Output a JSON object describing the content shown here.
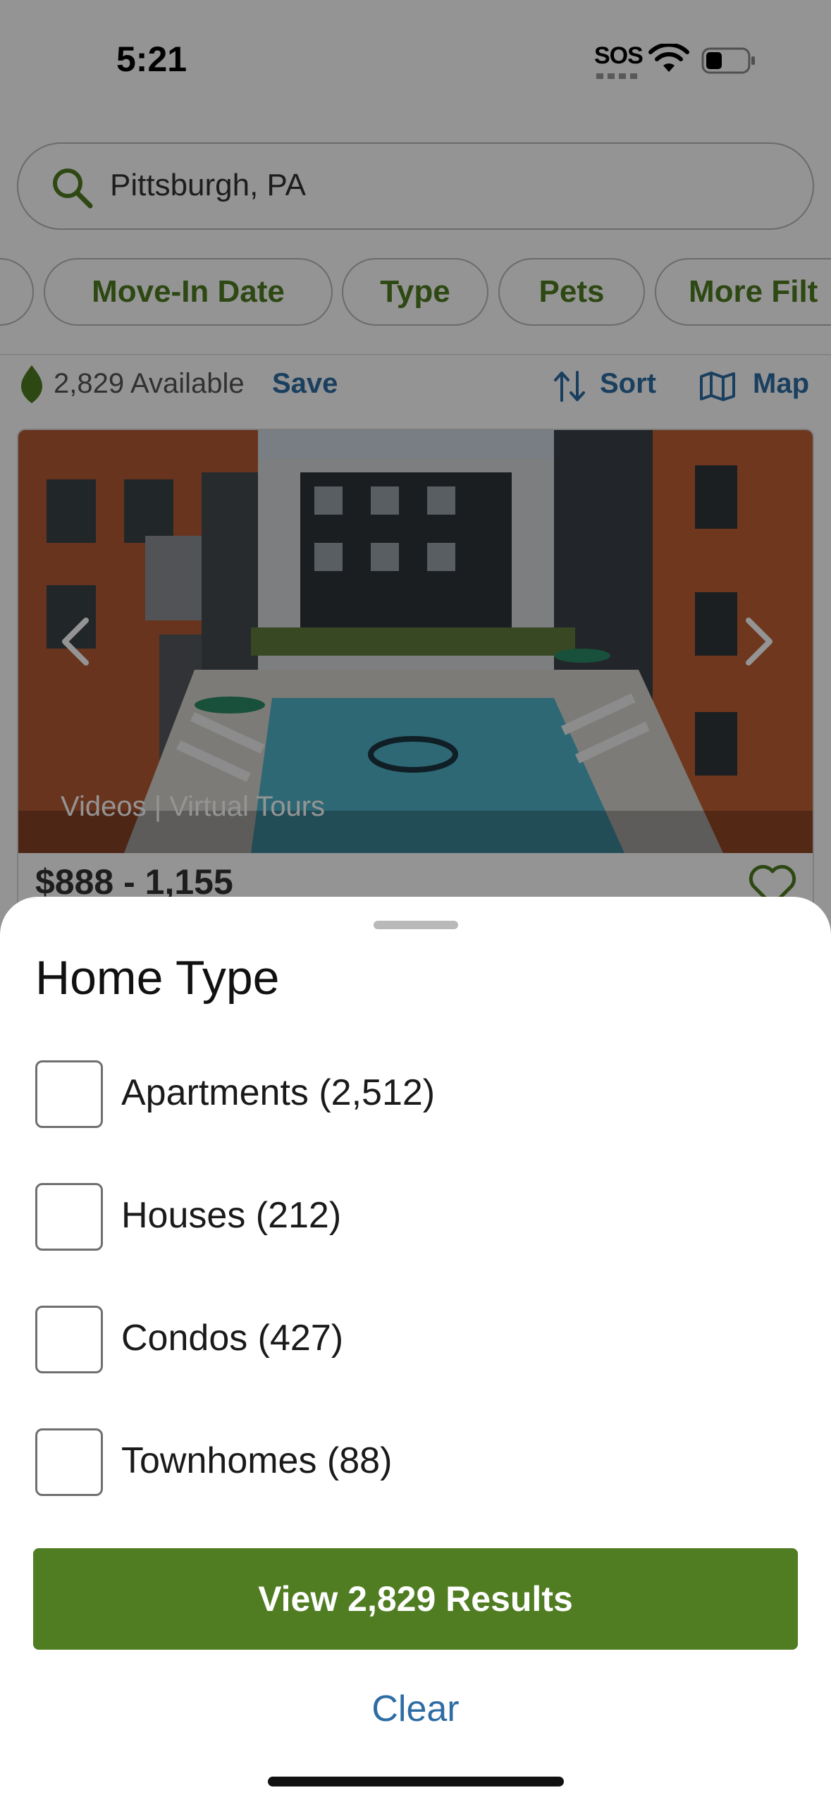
{
  "status_bar": {
    "time": "5:21",
    "sos": "SOS",
    "icons": [
      "wifi-icon",
      "battery-icon"
    ]
  },
  "search": {
    "value": "Pittsburgh, PA",
    "icon": "search-icon"
  },
  "filters": {
    "chips": [
      "Move-In Date",
      "Type",
      "Pets",
      "More Filt"
    ]
  },
  "results_bar": {
    "available": "2,829 Available",
    "save": "Save",
    "sort": "Sort",
    "map": "Map"
  },
  "listing": {
    "media": "Videos | Virtual Tours",
    "price": "$888 - 1,155"
  },
  "sheet": {
    "title": "Home Type",
    "options": [
      {
        "label": "Apartments (2,512)",
        "checked": false
      },
      {
        "label": "Houses (212)",
        "checked": false
      },
      {
        "label": "Condos (427)",
        "checked": false
      },
      {
        "label": "Townhomes (88)",
        "checked": false
      }
    ],
    "primary_button": "View 2,829 Results",
    "clear": "Clear"
  },
  "colors": {
    "brand_green": "#507c22",
    "chip_text_green": "#4e7c20",
    "link_blue": "#2e6da4"
  }
}
